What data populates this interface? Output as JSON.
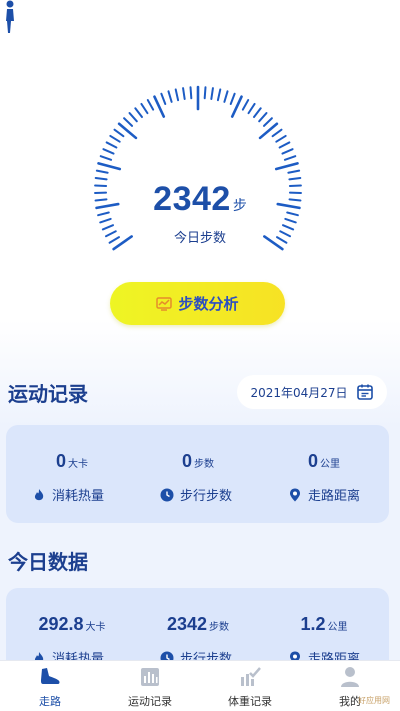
{
  "gauge": {
    "steps": "2342",
    "steps_unit": "步",
    "label": "今日步数"
  },
  "analysis_button": {
    "label": "步数分析"
  },
  "records": {
    "title": "运动记录",
    "date": "2021年04月27日",
    "stats": [
      {
        "value": "0",
        "unit": "大卡",
        "label": "消耗热量"
      },
      {
        "value": "0",
        "unit": "步数",
        "label": "步行步数"
      },
      {
        "value": "0",
        "unit": "公里",
        "label": "走路距离"
      }
    ]
  },
  "today": {
    "title": "今日数据",
    "stats": [
      {
        "value": "292.8",
        "unit": "大卡",
        "label": "消耗热量"
      },
      {
        "value": "2342",
        "unit": "步数",
        "label": "步行步数"
      },
      {
        "value": "1.2",
        "unit": "公里",
        "label": "走路距离"
      }
    ]
  },
  "tabs": [
    {
      "label": "走路"
    },
    {
      "label": "运动记录"
    },
    {
      "label": "体重记录"
    },
    {
      "label": "我的"
    }
  ],
  "colors": {
    "primary": "#1d4fa8",
    "button": "#f3ee26",
    "card": "#dbe6fb"
  },
  "watermark": "好应用网"
}
